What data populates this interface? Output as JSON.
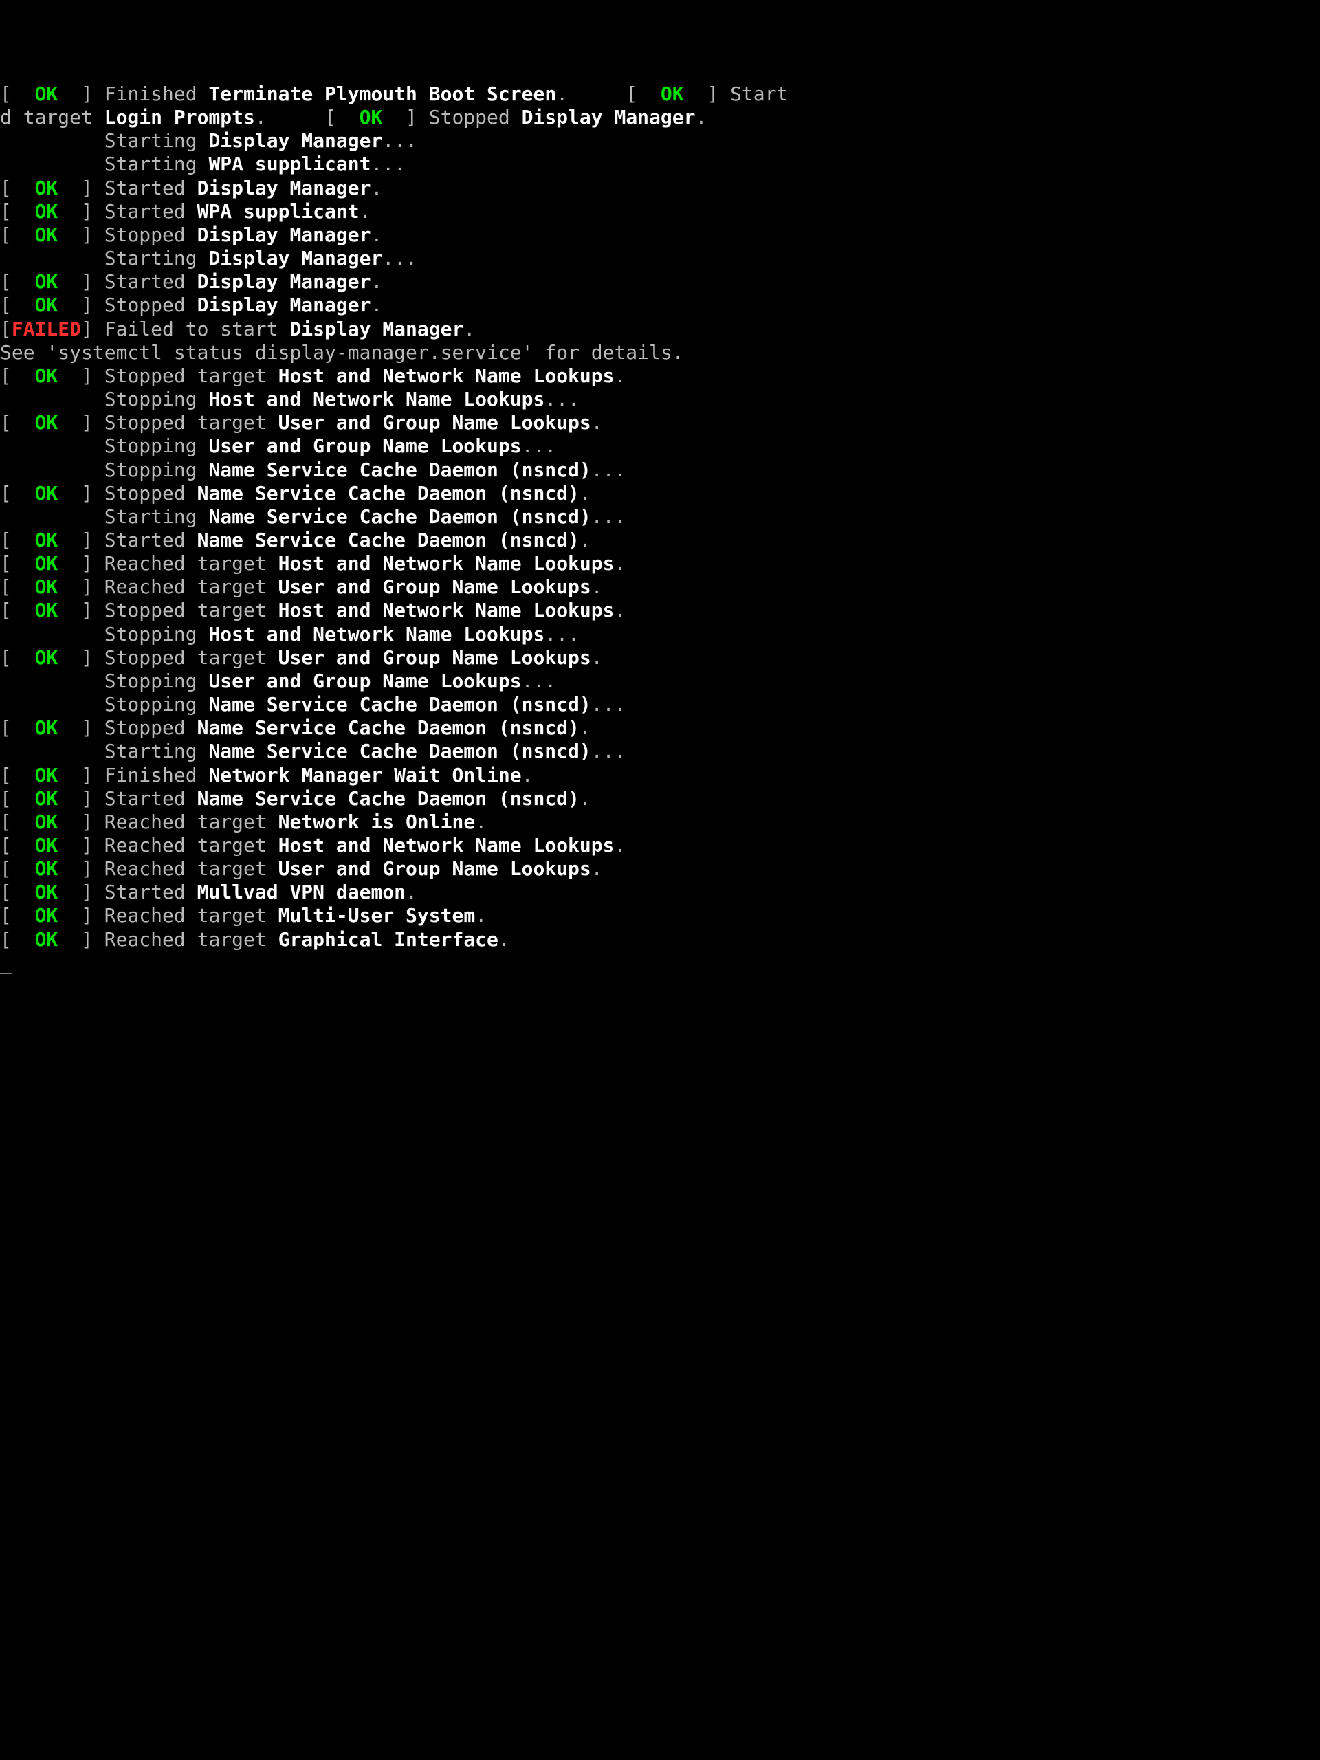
{
  "colors": {
    "ok": "#00e000",
    "failed": "#ff3030",
    "bold": "#ffffff",
    "normal": "#b8b8b8",
    "background": "#000000"
  },
  "lines": [
    {
      "segs": [
        {
          "t": "[  ",
          "c": "d"
        },
        {
          "t": "OK",
          "c": "g"
        },
        {
          "t": "  ] ",
          "c": "d"
        },
        {
          "t": "Finished ",
          "c": "d"
        },
        {
          "t": "Terminate Plymouth Boot Screen",
          "c": "w"
        },
        {
          "t": ".",
          "c": "d"
        },
        {
          "t": "     [  ",
          "c": "d"
        },
        {
          "t": "OK",
          "c": "g"
        },
        {
          "t": "  ] ",
          "c": "d"
        },
        {
          "t": "Start",
          "c": "d"
        }
      ]
    },
    {
      "segs": [
        {
          "t": "",
          "c": "d"
        }
      ]
    },
    {
      "segs": [
        {
          "t": "",
          "c": "d"
        }
      ]
    },
    {
      "segs": [
        {
          "t": "",
          "c": "d"
        }
      ]
    },
    {
      "segs": [
        {
          "t": "d target ",
          "c": "d"
        },
        {
          "t": "Login Prompts",
          "c": "w"
        },
        {
          "t": ".",
          "c": "d"
        },
        {
          "t": "     [  ",
          "c": "d"
        },
        {
          "t": "OK",
          "c": "g"
        },
        {
          "t": "  ] ",
          "c": "d"
        },
        {
          "t": "Stopped ",
          "c": "d"
        },
        {
          "t": "Display Manager",
          "c": "w"
        },
        {
          "t": ".",
          "c": "d"
        }
      ]
    },
    {
      "segs": [
        {
          "t": "         Starting ",
          "c": "d"
        },
        {
          "t": "Display Manager",
          "c": "w"
        },
        {
          "t": "...",
          "c": "d"
        }
      ]
    },
    {
      "segs": [
        {
          "t": "         Starting ",
          "c": "d"
        },
        {
          "t": "WPA supplicant",
          "c": "w"
        },
        {
          "t": "...",
          "c": "d"
        }
      ]
    },
    {
      "segs": [
        {
          "t": "[  ",
          "c": "d"
        },
        {
          "t": "OK",
          "c": "g"
        },
        {
          "t": "  ] ",
          "c": "d"
        },
        {
          "t": "Started ",
          "c": "d"
        },
        {
          "t": "Display Manager",
          "c": "w"
        },
        {
          "t": ".",
          "c": "d"
        }
      ]
    },
    {
      "segs": [
        {
          "t": "[  ",
          "c": "d"
        },
        {
          "t": "OK",
          "c": "g"
        },
        {
          "t": "  ] ",
          "c": "d"
        },
        {
          "t": "Started ",
          "c": "d"
        },
        {
          "t": "WPA supplicant",
          "c": "w"
        },
        {
          "t": ".",
          "c": "d"
        }
      ]
    },
    {
      "segs": [
        {
          "t": "[  ",
          "c": "d"
        },
        {
          "t": "OK",
          "c": "g"
        },
        {
          "t": "  ] ",
          "c": "d"
        },
        {
          "t": "Stopped ",
          "c": "d"
        },
        {
          "t": "Display Manager",
          "c": "w"
        },
        {
          "t": ".",
          "c": "d"
        }
      ]
    },
    {
      "segs": [
        {
          "t": "         Starting ",
          "c": "d"
        },
        {
          "t": "Display Manager",
          "c": "w"
        },
        {
          "t": "...",
          "c": "d"
        }
      ]
    },
    {
      "segs": [
        {
          "t": "[  ",
          "c": "d"
        },
        {
          "t": "OK",
          "c": "g"
        },
        {
          "t": "  ] ",
          "c": "d"
        },
        {
          "t": "Started ",
          "c": "d"
        },
        {
          "t": "Display Manager",
          "c": "w"
        },
        {
          "t": ".",
          "c": "d"
        }
      ]
    },
    {
      "segs": [
        {
          "t": "[  ",
          "c": "d"
        },
        {
          "t": "OK",
          "c": "g"
        },
        {
          "t": "  ] ",
          "c": "d"
        },
        {
          "t": "Stopped ",
          "c": "d"
        },
        {
          "t": "Display Manager",
          "c": "w"
        },
        {
          "t": ".",
          "c": "d"
        }
      ]
    },
    {
      "segs": [
        {
          "t": "[",
          "c": "d"
        },
        {
          "t": "FAILED",
          "c": "r"
        },
        {
          "t": "] ",
          "c": "d"
        },
        {
          "t": "Failed to start ",
          "c": "d"
        },
        {
          "t": "Display Manager",
          "c": "w"
        },
        {
          "t": ".",
          "c": "d"
        }
      ]
    },
    {
      "segs": [
        {
          "t": "See 'systemctl status display-manager.service' for details.",
          "c": "d"
        }
      ]
    },
    {
      "segs": [
        {
          "t": "[  ",
          "c": "d"
        },
        {
          "t": "OK",
          "c": "g"
        },
        {
          "t": "  ] ",
          "c": "d"
        },
        {
          "t": "Stopped target ",
          "c": "d"
        },
        {
          "t": "Host and Network Name Lookups",
          "c": "w"
        },
        {
          "t": ".",
          "c": "d"
        }
      ]
    },
    {
      "segs": [
        {
          "t": "         Stopping ",
          "c": "d"
        },
        {
          "t": "Host and Network Name Lookups",
          "c": "w"
        },
        {
          "t": "...",
          "c": "d"
        }
      ]
    },
    {
      "segs": [
        {
          "t": "[  ",
          "c": "d"
        },
        {
          "t": "OK",
          "c": "g"
        },
        {
          "t": "  ] ",
          "c": "d"
        },
        {
          "t": "Stopped target ",
          "c": "d"
        },
        {
          "t": "User and Group Name Lookups",
          "c": "w"
        },
        {
          "t": ".",
          "c": "d"
        }
      ]
    },
    {
      "segs": [
        {
          "t": "         Stopping ",
          "c": "d"
        },
        {
          "t": "User and Group Name Lookups",
          "c": "w"
        },
        {
          "t": "...",
          "c": "d"
        }
      ]
    },
    {
      "segs": [
        {
          "t": "         Stopping ",
          "c": "d"
        },
        {
          "t": "Name Service Cache Daemon (nsncd)",
          "c": "w"
        },
        {
          "t": "...",
          "c": "d"
        }
      ]
    },
    {
      "segs": [
        {
          "t": "[  ",
          "c": "d"
        },
        {
          "t": "OK",
          "c": "g"
        },
        {
          "t": "  ] ",
          "c": "d"
        },
        {
          "t": "Stopped ",
          "c": "d"
        },
        {
          "t": "Name Service Cache Daemon (nsncd)",
          "c": "w"
        },
        {
          "t": ".",
          "c": "d"
        }
      ]
    },
    {
      "segs": [
        {
          "t": "         Starting ",
          "c": "d"
        },
        {
          "t": "Name Service Cache Daemon (nsncd)",
          "c": "w"
        },
        {
          "t": "...",
          "c": "d"
        }
      ]
    },
    {
      "segs": [
        {
          "t": "[  ",
          "c": "d"
        },
        {
          "t": "OK",
          "c": "g"
        },
        {
          "t": "  ] ",
          "c": "d"
        },
        {
          "t": "Started ",
          "c": "d"
        },
        {
          "t": "Name Service Cache Daemon (nsncd)",
          "c": "w"
        },
        {
          "t": ".",
          "c": "d"
        }
      ]
    },
    {
      "segs": [
        {
          "t": "[  ",
          "c": "d"
        },
        {
          "t": "OK",
          "c": "g"
        },
        {
          "t": "  ] ",
          "c": "d"
        },
        {
          "t": "Reached target ",
          "c": "d"
        },
        {
          "t": "Host and Network Name Lookups",
          "c": "w"
        },
        {
          "t": ".",
          "c": "d"
        }
      ]
    },
    {
      "segs": [
        {
          "t": "[  ",
          "c": "d"
        },
        {
          "t": "OK",
          "c": "g"
        },
        {
          "t": "  ] ",
          "c": "d"
        },
        {
          "t": "Reached target ",
          "c": "d"
        },
        {
          "t": "User and Group Name Lookups",
          "c": "w"
        },
        {
          "t": ".",
          "c": "d"
        }
      ]
    },
    {
      "segs": [
        {
          "t": "[  ",
          "c": "d"
        },
        {
          "t": "OK",
          "c": "g"
        },
        {
          "t": "  ] ",
          "c": "d"
        },
        {
          "t": "Stopped target ",
          "c": "d"
        },
        {
          "t": "Host and Network Name Lookups",
          "c": "w"
        },
        {
          "t": ".",
          "c": "d"
        }
      ]
    },
    {
      "segs": [
        {
          "t": "         Stopping ",
          "c": "d"
        },
        {
          "t": "Host and Network Name Lookups",
          "c": "w"
        },
        {
          "t": "...",
          "c": "d"
        }
      ]
    },
    {
      "segs": [
        {
          "t": "[  ",
          "c": "d"
        },
        {
          "t": "OK",
          "c": "g"
        },
        {
          "t": "  ] ",
          "c": "d"
        },
        {
          "t": "Stopped target ",
          "c": "d"
        },
        {
          "t": "User and Group Name Lookups",
          "c": "w"
        },
        {
          "t": ".",
          "c": "d"
        }
      ]
    },
    {
      "segs": [
        {
          "t": "         Stopping ",
          "c": "d"
        },
        {
          "t": "User and Group Name Lookups",
          "c": "w"
        },
        {
          "t": "...",
          "c": "d"
        }
      ]
    },
    {
      "segs": [
        {
          "t": "         Stopping ",
          "c": "d"
        },
        {
          "t": "Name Service Cache Daemon (nsncd)",
          "c": "w"
        },
        {
          "t": "...",
          "c": "d"
        }
      ]
    },
    {
      "segs": [
        {
          "t": "[  ",
          "c": "d"
        },
        {
          "t": "OK",
          "c": "g"
        },
        {
          "t": "  ] ",
          "c": "d"
        },
        {
          "t": "Stopped ",
          "c": "d"
        },
        {
          "t": "Name Service Cache Daemon (nsncd)",
          "c": "w"
        },
        {
          "t": ".",
          "c": "d"
        }
      ]
    },
    {
      "segs": [
        {
          "t": "         Starting ",
          "c": "d"
        },
        {
          "t": "Name Service Cache Daemon (nsncd)",
          "c": "w"
        },
        {
          "t": "...",
          "c": "d"
        }
      ]
    },
    {
      "segs": [
        {
          "t": "[  ",
          "c": "d"
        },
        {
          "t": "OK",
          "c": "g"
        },
        {
          "t": "  ] ",
          "c": "d"
        },
        {
          "t": "Finished ",
          "c": "d"
        },
        {
          "t": "Network Manager Wait Online",
          "c": "w"
        },
        {
          "t": ".",
          "c": "d"
        }
      ]
    },
    {
      "segs": [
        {
          "t": "[  ",
          "c": "d"
        },
        {
          "t": "OK",
          "c": "g"
        },
        {
          "t": "  ] ",
          "c": "d"
        },
        {
          "t": "Started ",
          "c": "d"
        },
        {
          "t": "Name Service Cache Daemon (nsncd)",
          "c": "w"
        },
        {
          "t": ".",
          "c": "d"
        }
      ]
    },
    {
      "segs": [
        {
          "t": "[  ",
          "c": "d"
        },
        {
          "t": "OK",
          "c": "g"
        },
        {
          "t": "  ] ",
          "c": "d"
        },
        {
          "t": "Reached target ",
          "c": "d"
        },
        {
          "t": "Network is Online",
          "c": "w"
        },
        {
          "t": ".",
          "c": "d"
        }
      ]
    },
    {
      "segs": [
        {
          "t": "[  ",
          "c": "d"
        },
        {
          "t": "OK",
          "c": "g"
        },
        {
          "t": "  ] ",
          "c": "d"
        },
        {
          "t": "Reached target ",
          "c": "d"
        },
        {
          "t": "Host and Network Name Lookups",
          "c": "w"
        },
        {
          "t": ".",
          "c": "d"
        }
      ]
    },
    {
      "segs": [
        {
          "t": "[  ",
          "c": "d"
        },
        {
          "t": "OK",
          "c": "g"
        },
        {
          "t": "  ] ",
          "c": "d"
        },
        {
          "t": "Reached target ",
          "c": "d"
        },
        {
          "t": "User and Group Name Lookups",
          "c": "w"
        },
        {
          "t": ".",
          "c": "d"
        }
      ]
    },
    {
      "segs": [
        {
          "t": "[  ",
          "c": "d"
        },
        {
          "t": "OK",
          "c": "g"
        },
        {
          "t": "  ] ",
          "c": "d"
        },
        {
          "t": "Started ",
          "c": "d"
        },
        {
          "t": "Mullvad VPN daemon",
          "c": "w"
        },
        {
          "t": ".",
          "c": "d"
        }
      ]
    },
    {
      "segs": [
        {
          "t": "[  ",
          "c": "d"
        },
        {
          "t": "OK",
          "c": "g"
        },
        {
          "t": "  ] ",
          "c": "d"
        },
        {
          "t": "Reached target ",
          "c": "d"
        },
        {
          "t": "Multi-User System",
          "c": "w"
        },
        {
          "t": ".",
          "c": "d"
        }
      ]
    },
    {
      "segs": [
        {
          "t": "[  ",
          "c": "d"
        },
        {
          "t": "OK",
          "c": "g"
        },
        {
          "t": "  ] ",
          "c": "d"
        },
        {
          "t": "Reached target ",
          "c": "d"
        },
        {
          "t": "Graphical Interface",
          "c": "w"
        },
        {
          "t": ".",
          "c": "d"
        }
      ]
    },
    {
      "segs": [
        {
          "t": "_",
          "c": "cursor"
        }
      ]
    }
  ]
}
